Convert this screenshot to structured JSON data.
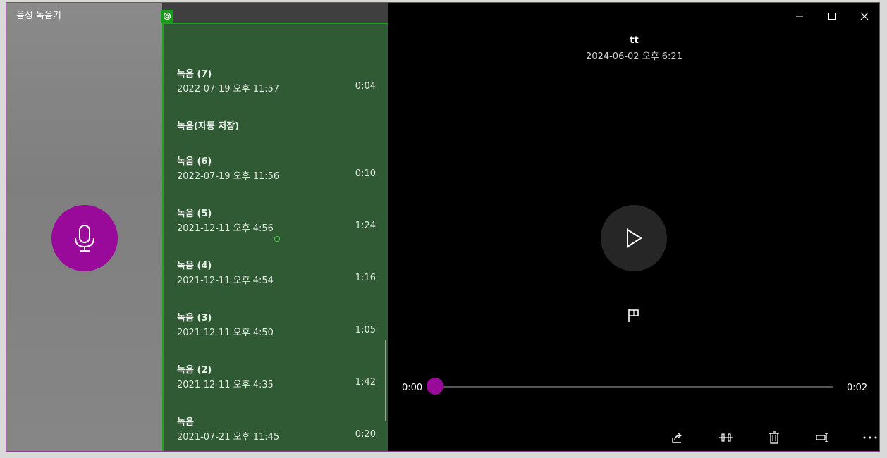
{
  "app": {
    "title": "음성 녹음기"
  },
  "colors": {
    "accent": "#9a0a9a",
    "list_bg": "#2f5a33",
    "list_border": "#1fa31f"
  },
  "recordings": [
    {
      "name": "녹음 (7)",
      "date": "2022-07-19 오후 11:57",
      "duration": "0:04"
    },
    {
      "name": "녹음 (6)",
      "date": "2022-07-19 오후 11:56",
      "duration": "0:10"
    },
    {
      "name": "녹음 (5)",
      "date": "2021-12-11 오후 4:56",
      "duration": "1:24"
    },
    {
      "name": "녹음 (4)",
      "date": "2021-12-11 오후 4:54",
      "duration": "1:16"
    },
    {
      "name": "녹음 (3)",
      "date": "2021-12-11 오후 4:50",
      "duration": "1:05"
    },
    {
      "name": "녹음 (2)",
      "date": "2021-12-11 오후 4:35",
      "duration": "1:42"
    },
    {
      "name": "녹음",
      "date": "2021-07-21 오후 11:45",
      "duration": "0:20"
    }
  ],
  "section_label": "녹음(자동 저장)",
  "player": {
    "title": "tt",
    "date": "2024-06-02 오후 6:21",
    "current_time": "0:00",
    "total_time": "0:02",
    "progress": 0
  },
  "icons": {
    "record": "microphone-icon",
    "play": "play-icon",
    "marker": "flag-icon",
    "share": "share-icon",
    "trim": "trim-icon",
    "delete": "trash-icon",
    "rename": "rename-icon",
    "more": "more-icon"
  }
}
